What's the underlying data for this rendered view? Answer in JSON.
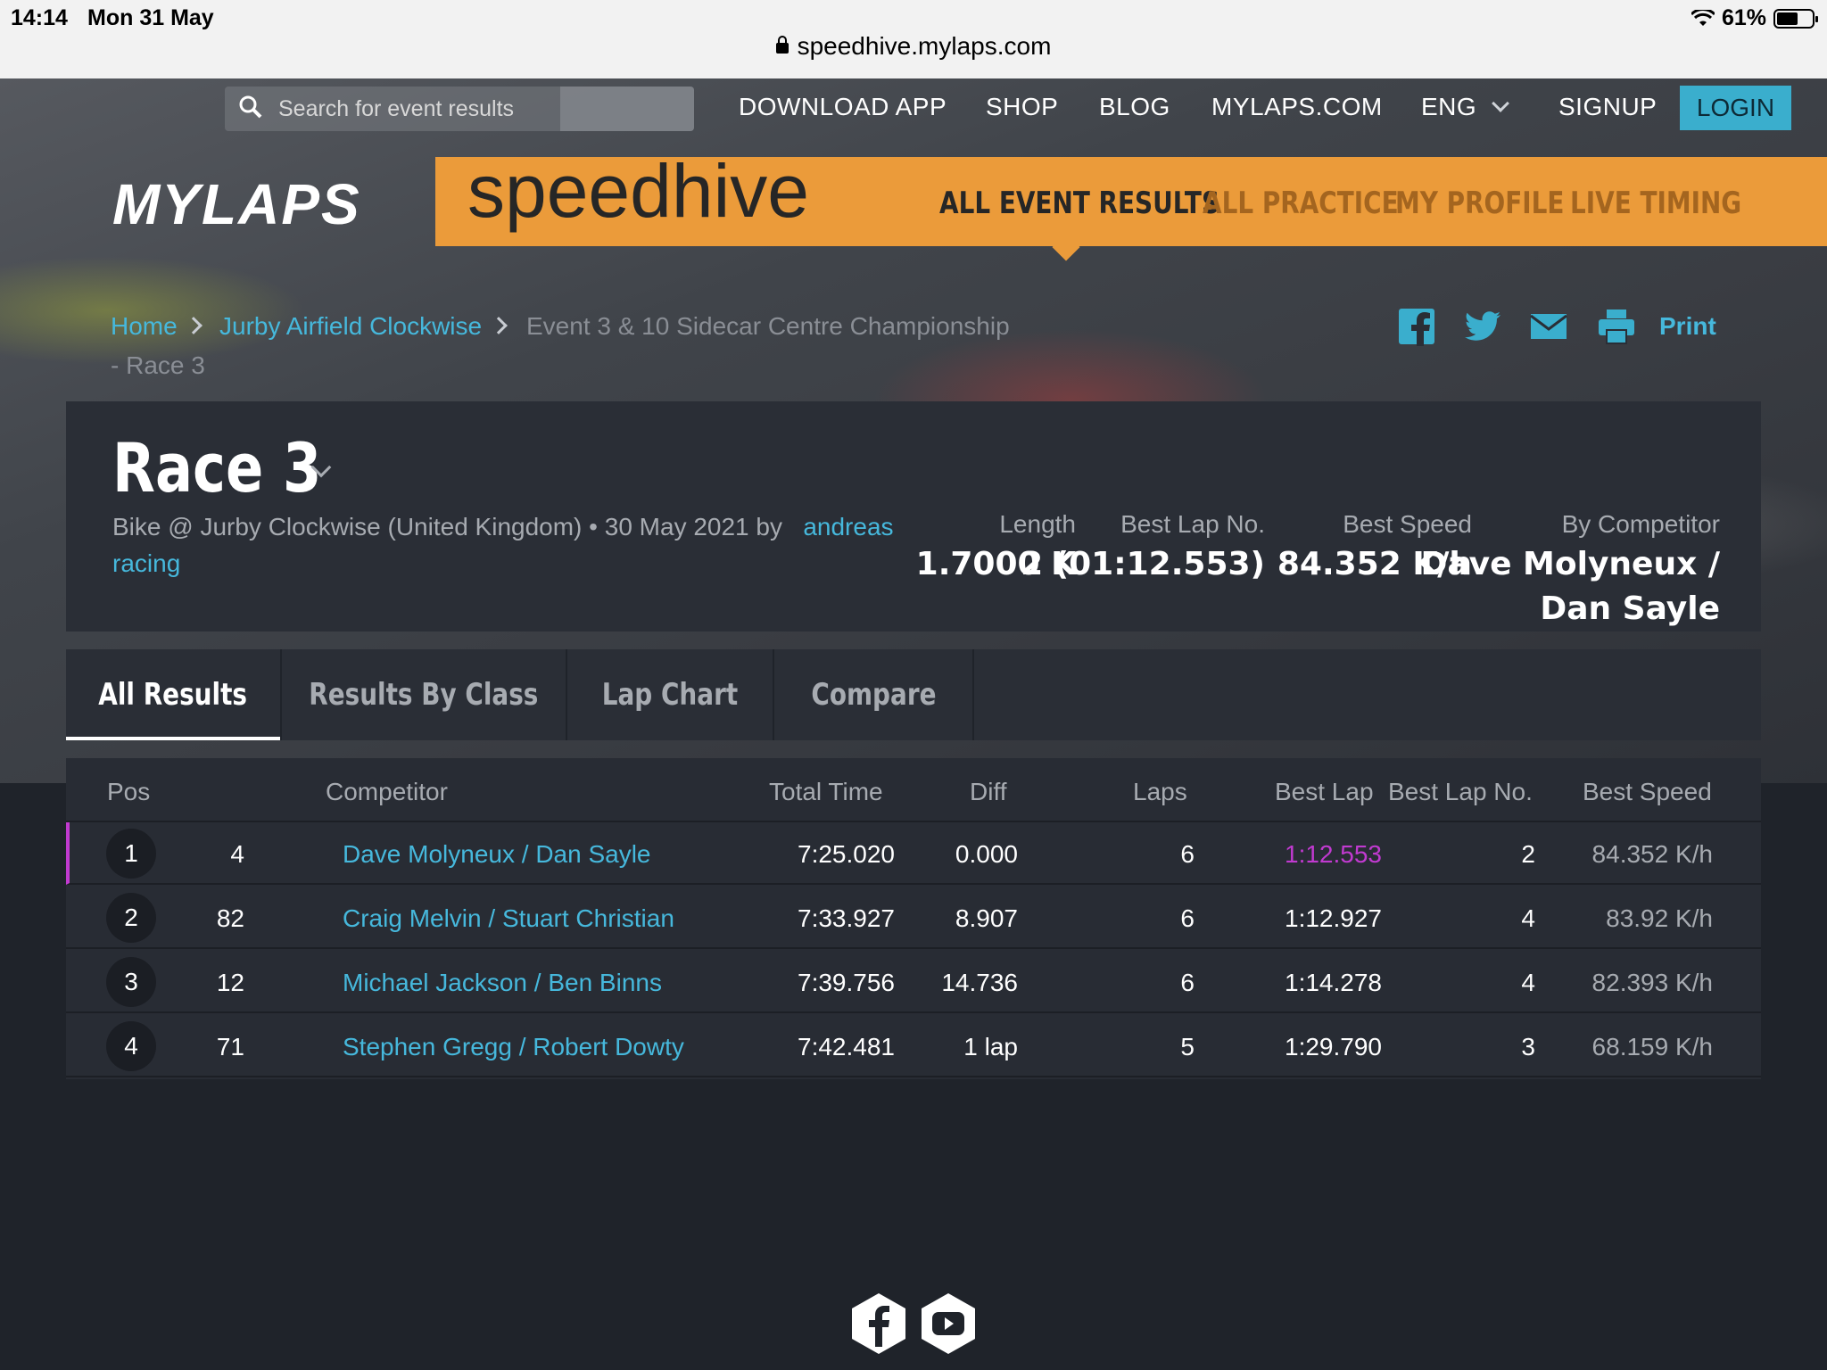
{
  "status_bar": {
    "time": "14:14",
    "date": "Mon 31 May",
    "battery": "61%"
  },
  "url": "speedhive.mylaps.com",
  "topnav": {
    "search_placeholder": "Search for event results",
    "download_app": "DOWNLOAD APP",
    "shop": "SHOP",
    "blog": "BLOG",
    "mylaps_com": "MYLAPS.COM",
    "language": "ENG",
    "signup": "SIGNUP",
    "login": "LOGIN"
  },
  "brand": {
    "mylaps": "MYLAPS",
    "speedhive": "speedhive",
    "nav": [
      "ALL EVENT RESULTS",
      "ALL PRACTICE",
      "MY PROFILE",
      "LIVE TIMING"
    ],
    "accent": "#eb9b3a"
  },
  "breadcrumb": {
    "home": "Home",
    "venue": "Jurby Airfield Clockwise",
    "event": "Event 3 & 10 Sidecar Centre Championship",
    "race": "- Race 3"
  },
  "share": {
    "print": "Print",
    "icons": [
      "facebook-icon",
      "twitter-icon",
      "mail-icon",
      "printer-icon"
    ]
  },
  "race": {
    "title": "Race 3",
    "meta": "Bike @ Jurby Clockwise (United Kingdom) • 30 May 2021 by",
    "author_a": "andreas",
    "author_b": "racing",
    "stats": {
      "length_label": "Length",
      "length_value": "1.7000 K",
      "best_lap_label": "Best Lap No.",
      "best_lap_value": "2 (01:12.553)",
      "best_speed_label": "Best Speed",
      "best_speed_value": "84.352 K/h",
      "by_comp_label": "By Competitor",
      "by_comp_value_1": "Dave Molyneux /",
      "by_comp_value_2": "Dan Sayle"
    }
  },
  "tabs": [
    "All Results",
    "Results By Class",
    "Lap Chart",
    "Compare"
  ],
  "table": {
    "headers": {
      "pos": "Pos",
      "competitor": "Competitor",
      "total_time": "Total Time",
      "diff": "Diff",
      "laps": "Laps",
      "best_lap": "Best Lap",
      "best_lap_no": "Best Lap No.",
      "best_speed": "Best Speed"
    },
    "rows": [
      {
        "pos": "1",
        "num": "4",
        "competitor": "Dave Molyneux / Dan Sayle",
        "total": "7:25.020",
        "diff": "0.000",
        "laps": "6",
        "best_lap": "1:12.553",
        "best_lap_no": "2",
        "speed": "84.352 K/h"
      },
      {
        "pos": "2",
        "num": "82",
        "competitor": "Craig Melvin / Stuart Christian",
        "total": "7:33.927",
        "diff": "8.907",
        "laps": "6",
        "best_lap": "1:12.927",
        "best_lap_no": "4",
        "speed": "83.92 K/h"
      },
      {
        "pos": "3",
        "num": "12",
        "competitor": "Michael Jackson / Ben Binns",
        "total": "7:39.756",
        "diff": "14.736",
        "laps": "6",
        "best_lap": "1:14.278",
        "best_lap_no": "4",
        "speed": "82.393 K/h"
      },
      {
        "pos": "4",
        "num": "71",
        "competitor": "Stephen Gregg / Robert Dowty",
        "total": "7:42.481",
        "diff": "1 lap",
        "laps": "5",
        "best_lap": "1:29.790",
        "best_lap_no": "3",
        "speed": "68.159 K/h"
      }
    ],
    "fastest_color": "#c13ad0",
    "link_color": "#46b8dc"
  },
  "footer": {
    "icons": [
      "facebook-icon",
      "youtube-icon"
    ]
  }
}
